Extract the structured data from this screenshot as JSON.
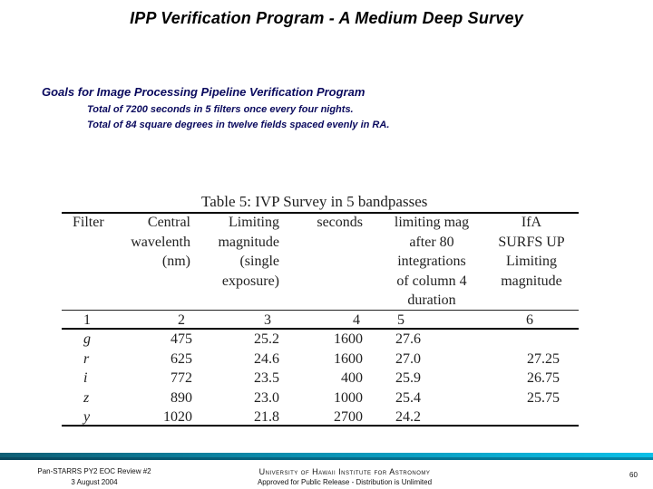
{
  "slide": {
    "title": "IPP  Verification  Program   - A Medium Deep Survey"
  },
  "goals": {
    "heading": "Goals for Image Processing Pipeline Verification Program",
    "lines": [
      "Total of 7200 seconds in 5  filters once every four nights.",
      "Total of 84 square degrees in  twelve fields spaced  evenly in RA."
    ]
  },
  "table": {
    "caption": "Table 5: IVP Survey in 5 bandpasses",
    "headers": [
      [
        "Filter"
      ],
      [
        "Central",
        "wavelenth",
        "(nm)"
      ],
      [
        "Limiting",
        "magnitude",
        "(single",
        "exposure)"
      ],
      [
        "seconds"
      ],
      [
        "limiting mag",
        "after 80",
        "integrations",
        "of column 4",
        "duration"
      ],
      [
        "IfA",
        "SURFS UP",
        "Limiting",
        "magnitude"
      ]
    ],
    "column_numbers": [
      "1",
      "2",
      "3",
      "4",
      "5",
      "6"
    ],
    "rows": [
      {
        "filter": "g",
        "wavelength": "475",
        "limiting_mag_single": "25.2",
        "seconds": "1600",
        "limiting_mag_80": "27.6",
        "ifa_surfs_up": ""
      },
      {
        "filter": "r",
        "wavelength": "625",
        "limiting_mag_single": "24.6",
        "seconds": "1600",
        "limiting_mag_80": "27.0",
        "ifa_surfs_up": "27.25"
      },
      {
        "filter": "i",
        "wavelength": "772",
        "limiting_mag_single": "23.5",
        "seconds": "400",
        "limiting_mag_80": "25.9",
        "ifa_surfs_up": "26.75"
      },
      {
        "filter": "z",
        "wavelength": "890",
        "limiting_mag_single": "23.0",
        "seconds": "1000",
        "limiting_mag_80": "25.4",
        "ifa_surfs_up": "25.75"
      },
      {
        "filter": "y",
        "wavelength": "1020",
        "limiting_mag_single": "21.8",
        "seconds": "2700",
        "limiting_mag_80": "24.2",
        "ifa_surfs_up": ""
      }
    ]
  },
  "footer": {
    "left_line1": "Pan-STARRS  PY2  EOC Review  #2",
    "left_line2": "3  August  2004",
    "center_line1": "University of Hawaii Institute for Astronomy",
    "center_line2": "Approved for Public Release - Distribution is Unlimited",
    "page_number": "60",
    "bar_colors": [
      "#0f5e74",
      "#0a8fb0",
      "#0ac0e8"
    ]
  }
}
